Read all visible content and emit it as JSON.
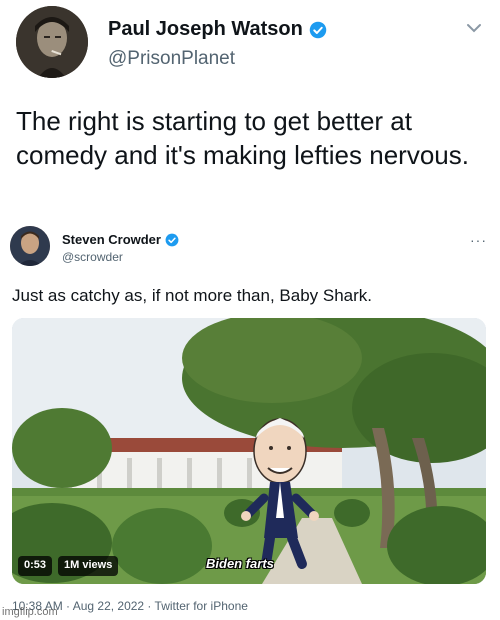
{
  "outer_tweet": {
    "author_name": "Paul Joseph Watson",
    "handle": "@PrisonPlanet",
    "text": "The right is starting to get better at comedy and it's making lefties nervous."
  },
  "quoted_tweet": {
    "author_name": "Steven Crowder",
    "handle": "@scrowder",
    "more_label": "···",
    "text": "Just as catchy as, if not more than, Baby Shark.",
    "video": {
      "duration": "0:53",
      "views": "1M views",
      "caption": "Biden farts"
    },
    "footer": "10:38 AM · Aug 22, 2022 · Twitter for iPhone"
  },
  "watermark": "imgflip.com",
  "colors": {
    "verified": "#1d9bf0",
    "text": "#0f1419",
    "secondary": "#536471"
  }
}
